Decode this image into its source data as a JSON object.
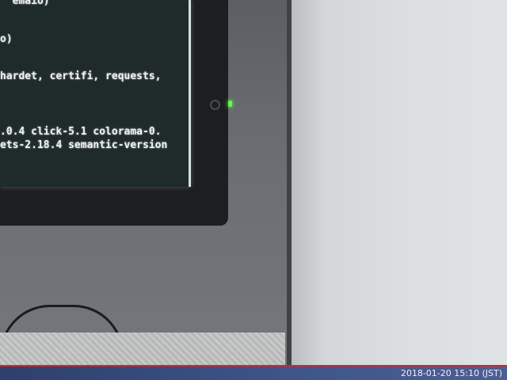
{
  "terminal": {
    "lines": [
      "  emaio)",
      "o)",
      "hardet, certifi, requests,",
      ".0.4 click-5.1 colorama-0.",
      "ets-2.18.4 semantic-version"
    ]
  },
  "overlay": {
    "timestamp": "2018-01-20 15:10 (JST)"
  },
  "colors": {
    "led": "#5cff4a",
    "timestamp_bar": "#3b4f85",
    "timestamp_rule": "#dd2222"
  }
}
